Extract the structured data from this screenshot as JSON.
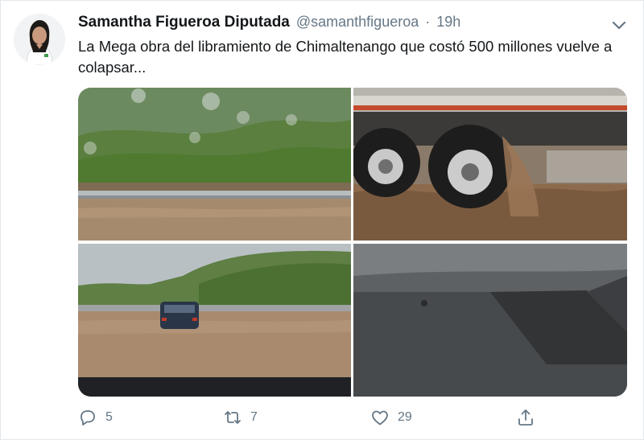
{
  "tweet": {
    "display_name": "Samantha Figueroa Diputada",
    "handle": "@samanthfigueroa",
    "separator": "·",
    "time": "19h",
    "text": "La Mega obra del libramiento de Chimaltenango que costó 500 millones vuelve a colapsar..."
  },
  "media": [
    {
      "name": "photo-flooded-highway",
      "icon": "image"
    },
    {
      "name": "photo-truck-wheels-in-mud",
      "icon": "image"
    },
    {
      "name": "photo-car-on-flooded-road",
      "icon": "image"
    },
    {
      "name": "photo-car-dashboard",
      "icon": "image"
    }
  ],
  "actions": {
    "reply_count": "5",
    "retweet_count": "7",
    "like_count": "29"
  },
  "icons": {
    "more": "chevron-down-icon",
    "reply": "reply-icon",
    "retweet": "retweet-icon",
    "like": "heart-icon",
    "share": "share-icon"
  },
  "colors": {
    "text": "#14171a",
    "secondary": "#657786",
    "border": "#e1e8ed"
  }
}
